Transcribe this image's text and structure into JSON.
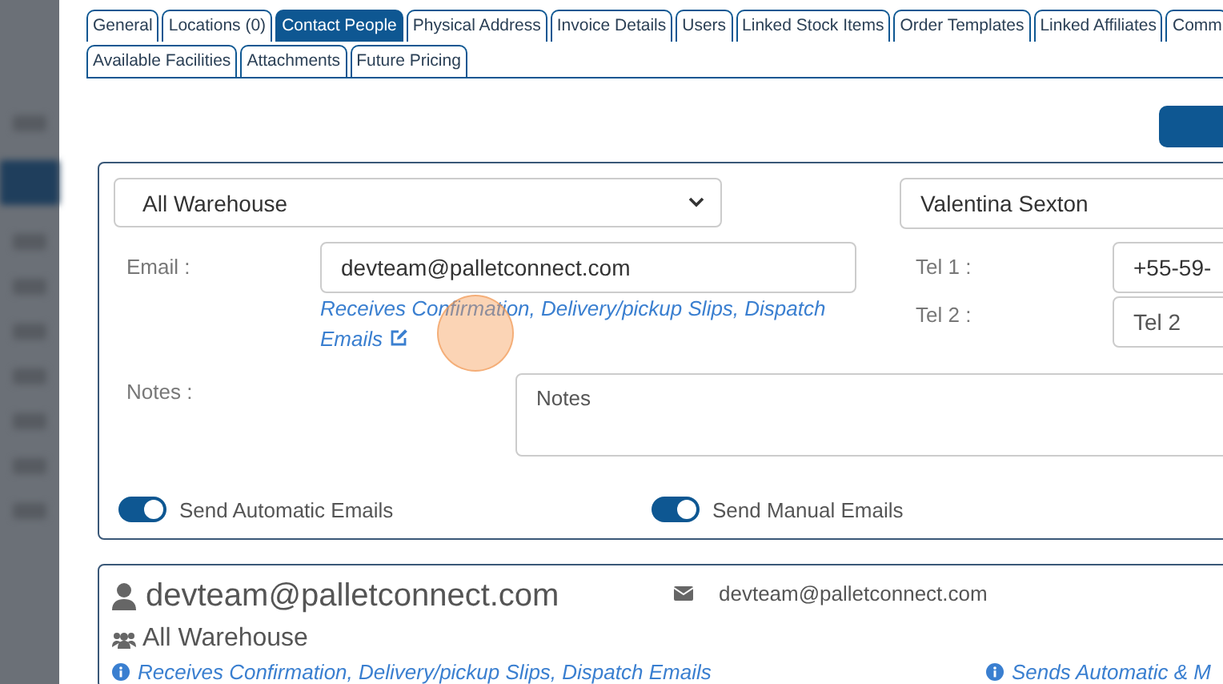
{
  "tabs": [
    {
      "label": "General",
      "selected": false
    },
    {
      "label": "Locations (0)",
      "selected": false
    },
    {
      "label": "Contact People",
      "selected": true
    },
    {
      "label": "Physical Address",
      "selected": false
    },
    {
      "label": "Invoice Details",
      "selected": false
    },
    {
      "label": "Users",
      "selected": false
    },
    {
      "label": "Linked Stock Items",
      "selected": false
    },
    {
      "label": "Order Templates",
      "selected": false
    },
    {
      "label": "Linked Affiliates",
      "selected": false
    },
    {
      "label": "Comm",
      "selected": false
    },
    {
      "label": "Available Facilities",
      "selected": false
    },
    {
      "label": "Attachments",
      "selected": false
    },
    {
      "label": "Future Pricing",
      "selected": false
    }
  ],
  "contact_form": {
    "warehouse_select": {
      "value": "All Warehouse"
    },
    "name_field": {
      "value": "Valentina Sexton"
    },
    "email": {
      "label": "Email :",
      "value": "devteam@palletconnect.com"
    },
    "email_types_link": "Receives Confirmation, Delivery/pickup Slips, Dispatch Emails",
    "tel_1": {
      "label": "Tel 1 :",
      "value": "+55-59-"
    },
    "tel_2": {
      "label": "Tel 2 :",
      "placeholder": "Tel 2"
    },
    "notes": {
      "label": "Notes :",
      "placeholder": "Notes"
    },
    "toggles": [
      {
        "label": "Send Automatic Emails",
        "on": true
      },
      {
        "label": "Send Manual Emails",
        "on": true
      }
    ]
  },
  "contact_card": {
    "name": "devteam@palletconnect.com",
    "email": "devteam@palletconnect.com",
    "group": "All Warehouse",
    "email_types": "Receives Confirmation, Delivery/pickup Slips, Dispatch Emails",
    "sending": "Sends Automatic & M"
  }
}
